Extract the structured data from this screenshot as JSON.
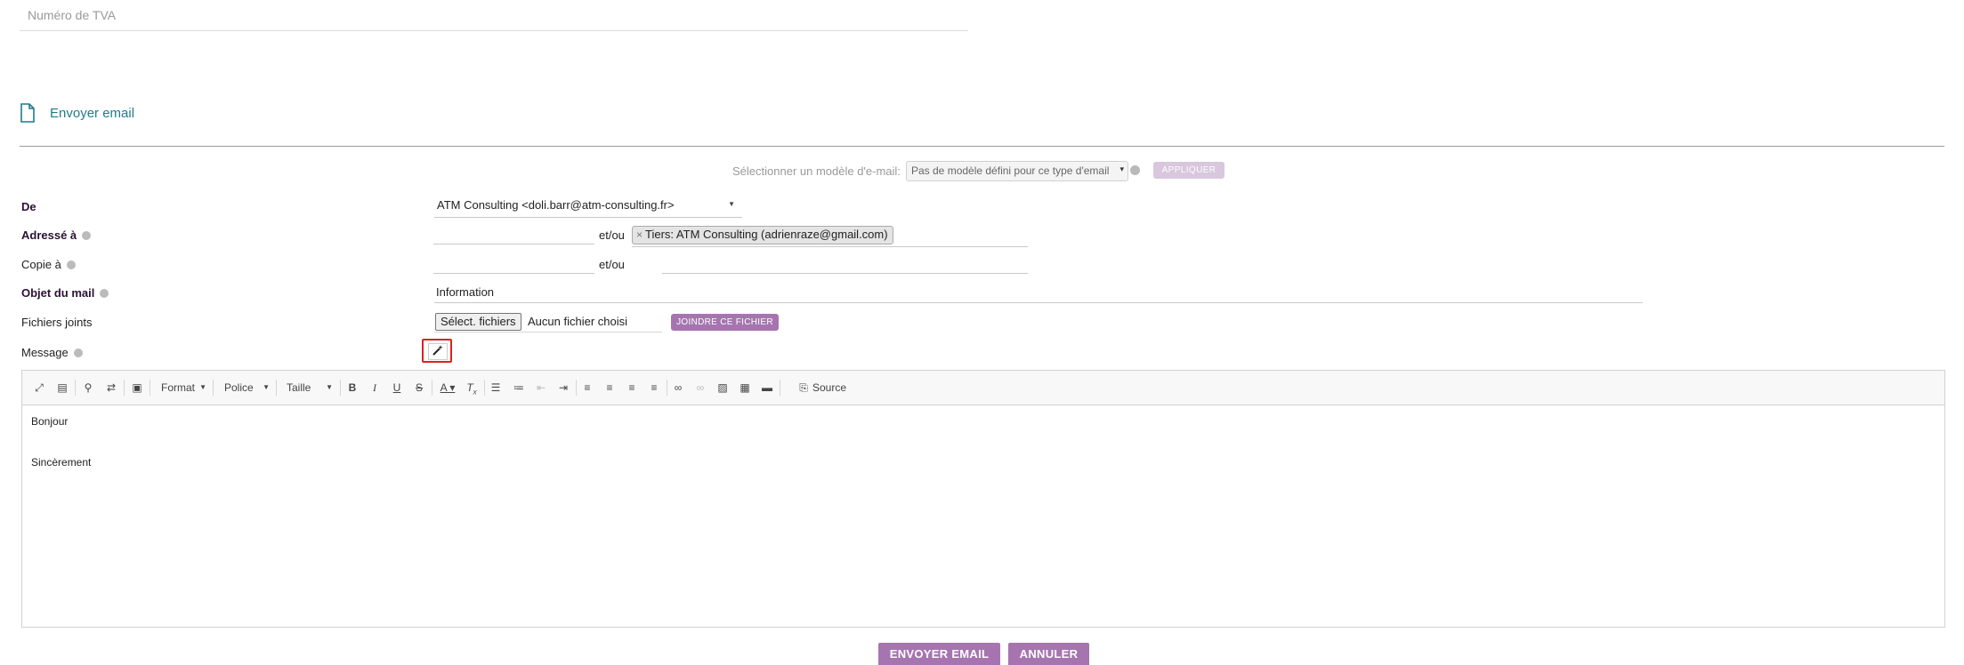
{
  "top_field": {
    "placeholder": "Numéro de TVA"
  },
  "section": {
    "title": "Envoyer email",
    "icon": "file-icon"
  },
  "template": {
    "label": "Sélectionner un modèle d'e-mail:",
    "selected": "Pas de modèle défini pour ce type d'email",
    "apply_label": "APPLIQUER"
  },
  "form": {
    "from_label": "De",
    "from_value": "ATM Consulting <doli.barr@atm-consulting.fr>",
    "to_label": "Adressé à",
    "to_and_or": "et/ou",
    "to_tag": "Tiers: ATM Consulting (adrienraze@gmail.com)",
    "cc_label": "Copie à",
    "cc_and_or": "et/ou",
    "subject_label": "Objet du mail",
    "subject_value": "Information",
    "files_label": "Fichiers joints",
    "files_button": "Sélect. fichiers",
    "files_none": "Aucun fichier choisi",
    "attach_label": "JOINDRE CE FICHIER",
    "message_label": "Message"
  },
  "editor": {
    "toolbar": {
      "format_label": "Format",
      "font_label": "Police",
      "size_label": "Taille",
      "source_label": "Source"
    },
    "content": {
      "line1": "Bonjour",
      "line2": "Sincèrement"
    }
  },
  "actions": {
    "send_label": "ENVOYER EMAIL",
    "cancel_label": "ANNULER"
  },
  "colors": {
    "accent": "#a675b0",
    "section_title": "#1f7b8c",
    "highlight_border": "#e02020"
  }
}
